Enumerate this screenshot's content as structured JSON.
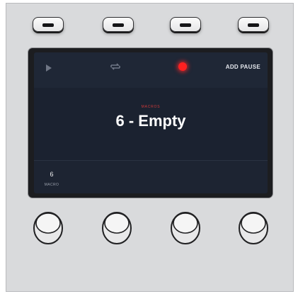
{
  "soft_buttons": [
    "button-1",
    "button-2",
    "button-3",
    "button-4"
  ],
  "lcd": {
    "icons": {
      "play": "play-icon",
      "loop": "loop-icon",
      "record": "record-icon"
    },
    "record_color": "#ff2020",
    "add_pause_label": "ADD PAUSE",
    "macro_label": "MACROS",
    "macro_title": "6 - Empty",
    "knob_value": "6",
    "knob_caption": "MACRO"
  },
  "knobs": [
    "knob-1",
    "knob-2",
    "knob-3",
    "knob-4"
  ]
}
